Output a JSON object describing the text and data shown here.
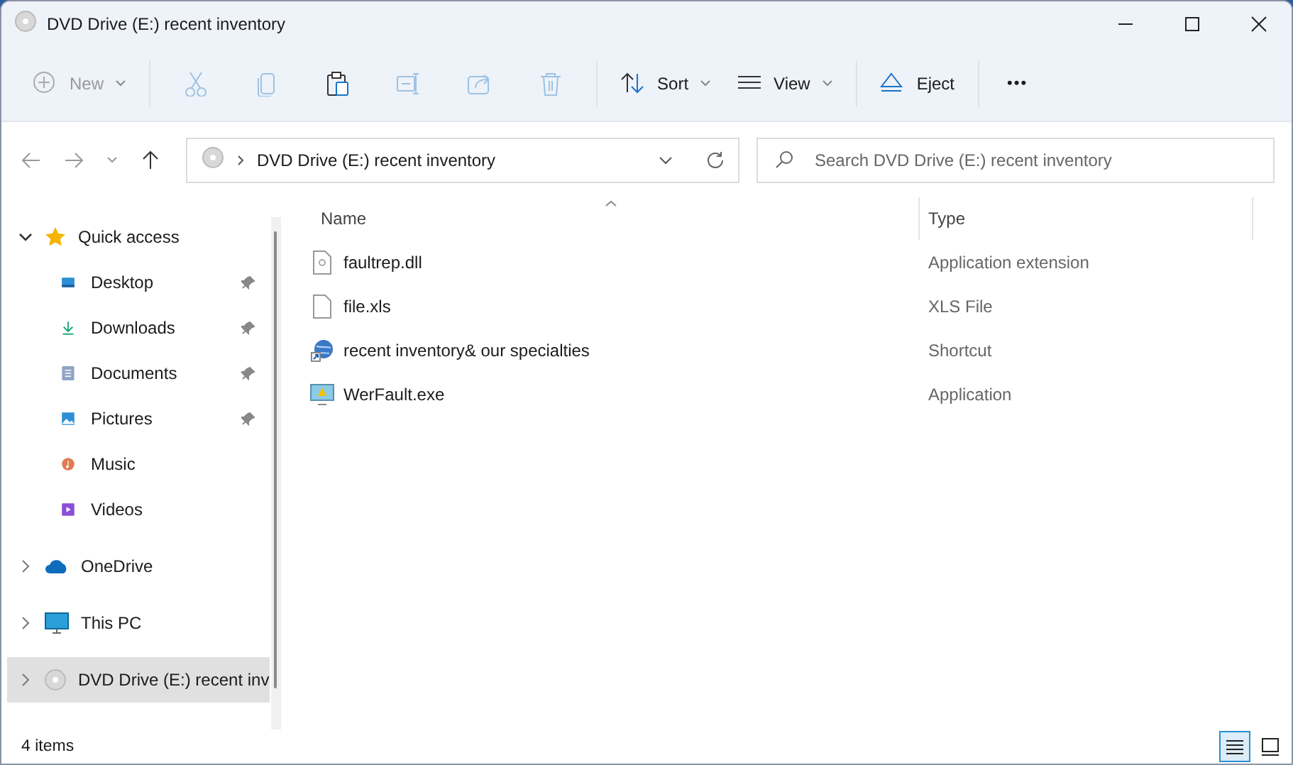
{
  "window": {
    "title": "DVD Drive (E:) recent inventory"
  },
  "toolbar": [
    {
      "kind": "button",
      "label": "New",
      "dropdown": true,
      "disabled": true
    },
    {
      "kind": "separator"
    },
    {
      "kind": "icon",
      "disabled": true
    },
    {
      "kind": "icon",
      "disabled": true
    },
    {
      "kind": "icon",
      "disabled": false
    },
    {
      "kind": "icon",
      "disabled": true
    },
    {
      "kind": "icon",
      "disabled": true
    },
    {
      "kind": "icon",
      "disabled": true
    },
    {
      "kind": "separator"
    },
    {
      "kind": "button",
      "label": "Sort",
      "dropdown": true,
      "disabled": false
    },
    {
      "kind": "button",
      "label": "View",
      "dropdown": true,
      "disabled": false
    },
    {
      "kind": "separator"
    },
    {
      "kind": "button",
      "label": "Eject",
      "dropdown": false,
      "disabled": false
    },
    {
      "kind": "separator"
    },
    {
      "kind": "more",
      "label": "•••",
      "disabled": false
    }
  ],
  "address": {
    "path": "DVD Drive (E:) recent inventory"
  },
  "search": {
    "placeholder": "Search DVD Drive (E:) recent inventory"
  },
  "sidebar": {
    "items": [
      {
        "label": "Quick access",
        "expanded": true,
        "selected": false,
        "children": [
          {
            "label": "Desktop",
            "pinned": true,
            "selected": false
          },
          {
            "label": "Downloads",
            "pinned": true,
            "selected": false
          },
          {
            "label": "Documents",
            "pinned": true,
            "selected": false
          },
          {
            "label": "Pictures",
            "pinned": true,
            "selected": false
          },
          {
            "label": "Music",
            "pinned": false,
            "selected": false
          },
          {
            "label": "Videos",
            "pinned": false,
            "selected": false
          }
        ]
      },
      {
        "label": "OneDrive",
        "expanded": false,
        "selected": false
      },
      {
        "label": "This PC",
        "expanded": false,
        "selected": false
      },
      {
        "label": "DVD Drive (E:) recent inv",
        "expanded": false,
        "selected": true
      }
    ]
  },
  "table": {
    "columns": [
      {
        "label": "Name",
        "sorted": true
      },
      {
        "label": "Type",
        "sorted": false
      }
    ],
    "rows": [
      {
        "name": "faultrep.dll",
        "type": "Application extension",
        "selected": false
      },
      {
        "name": "file.xls",
        "type": "XLS File",
        "selected": false
      },
      {
        "name": "recent inventory& our specialties",
        "type": "Shortcut",
        "selected": false
      },
      {
        "name": "WerFault.exe",
        "type": "Application",
        "selected": false
      }
    ]
  },
  "status_bar": {
    "count": "4 items",
    "views": [
      {
        "selected": true
      },
      {
        "selected": false
      }
    ]
  }
}
